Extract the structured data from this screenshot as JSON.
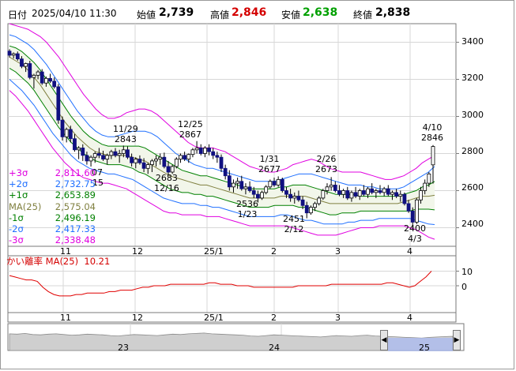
{
  "header": {
    "date_label": "日付",
    "datetime": "2025/04/10 11:30",
    "open_label": "始値",
    "open_value": "2,739",
    "high_label": "高値",
    "high_value": "2,846",
    "low_label": "安値",
    "low_value": "2,638",
    "close_label": "終値",
    "close_value": "2,838",
    "colors": {
      "high": "#d40000",
      "low": "#00a000"
    }
  },
  "legend": [
    {
      "label": "+3σ",
      "value": "2,811.60",
      "color": "#e000e0"
    },
    {
      "label": "+2σ",
      "value": "2,732.75",
      "color": "#2070ff"
    },
    {
      "label": "+1σ",
      "value": "2,653.89",
      "color": "#008000"
    },
    {
      "label": "MA(25)",
      "value": "2,575.04",
      "color": "#808040"
    },
    {
      "label": "-1σ",
      "value": "2,496.19",
      "color": "#008000"
    },
    {
      "label": "-2σ",
      "value": "2,417.33",
      "color": "#2070ff"
    },
    {
      "label": "-3σ",
      "value": "2,338.48",
      "color": "#e000e0"
    }
  ],
  "annotations": {
    "a_1129_date": "11/29",
    "a_1129_val": "2843",
    "a_1225_date": "12/25",
    "a_1225_val": "2867",
    "a_131_date": "1/31",
    "a_131_val": "2677",
    "a_226_date": "2/26",
    "a_226_val": "2673",
    "a_410_date": "4/10",
    "a_410_val": "2846",
    "a_1216_val": "2683",
    "a_1216_date": "12/16",
    "a_123_val": "2536",
    "a_123_date": "1/23",
    "a_212_val": "2451",
    "a_212_date": "2/12",
    "a_43_val": "2400",
    "a_43_date": "4/3",
    "partial_low_1": "07",
    "partial_low_2": "15"
  },
  "y_axis_labels": [
    "3400",
    "3200",
    "3000",
    "2800",
    "2600",
    "2400"
  ],
  "x_axis_labels": [
    "11",
    "12",
    "25/1",
    "2",
    "3",
    "4"
  ],
  "sub_indicator": {
    "label": "かい離率 MA(25)",
    "value": "10.21",
    "y_labels": [
      "10",
      "0"
    ]
  },
  "navigator": {
    "labels": [
      "23",
      "24",
      "25"
    ],
    "left_button": "◀",
    "right_button": "▶"
  },
  "chart_data": {
    "type": "candlestick",
    "y_range": [
      2300,
      3500
    ],
    "candles": [
      [
        3352,
        3362,
        3318,
        3330
      ],
      [
        3330,
        3345,
        3312,
        3338
      ],
      [
        3338,
        3350,
        3300,
        3310
      ],
      [
        3310,
        3325,
        3260,
        3270
      ],
      [
        3270,
        3290,
        3240,
        3285
      ],
      [
        3285,
        3300,
        3200,
        3210
      ],
      [
        3210,
        3230,
        3150,
        3222
      ],
      [
        3222,
        3250,
        3200,
        3240
      ],
      [
        3240,
        3255,
        3170,
        3180
      ],
      [
        3180,
        3215,
        3160,
        3205
      ],
      [
        3205,
        3230,
        3180,
        3190
      ],
      [
        3190,
        3210,
        3150,
        3160
      ],
      [
        3160,
        3175,
        2960,
        2980
      ],
      [
        2980,
        3000,
        2870,
        2890
      ],
      [
        2890,
        2940,
        2860,
        2930
      ],
      [
        2930,
        2950,
        2860,
        2880
      ],
      [
        2880,
        2905,
        2810,
        2820
      ],
      [
        2820,
        2840,
        2770,
        2830
      ],
      [
        2830,
        2850,
        2760,
        2790
      ],
      [
        2790,
        2810,
        2740,
        2760
      ],
      [
        2760,
        2790,
        2730,
        2780
      ],
      [
        2780,
        2810,
        2750,
        2800
      ],
      [
        2800,
        2830,
        2775,
        2790
      ],
      [
        2790,
        2815,
        2760,
        2770
      ],
      [
        2770,
        2800,
        2740,
        2790
      ],
      [
        2790,
        2820,
        2770,
        2810
      ],
      [
        2810,
        2830,
        2780,
        2790
      ],
      [
        2790,
        2820,
        2750,
        2800
      ],
      [
        2800,
        2843,
        2780,
        2820
      ],
      [
        2820,
        2838,
        2770,
        2780
      ],
      [
        2780,
        2800,
        2730,
        2750
      ],
      [
        2750,
        2780,
        2720,
        2770
      ],
      [
        2770,
        2790,
        2740,
        2750
      ],
      [
        2750,
        2775,
        2700,
        2720
      ],
      [
        2720,
        2750,
        2690,
        2740
      ],
      [
        2740,
        2770,
        2700,
        2760
      ],
      [
        2760,
        2790,
        2730,
        2770
      ],
      [
        2770,
        2800,
        2740,
        2780
      ],
      [
        2780,
        2805,
        2720,
        2730
      ],
      [
        2730,
        2760,
        2683,
        2700
      ],
      [
        2700,
        2740,
        2690,
        2730
      ],
      [
        2730,
        2780,
        2720,
        2770
      ],
      [
        2770,
        2800,
        2750,
        2790
      ],
      [
        2790,
        2810,
        2760,
        2770
      ],
      [
        2770,
        2800,
        2750,
        2795
      ],
      [
        2795,
        2830,
        2780,
        2820
      ],
      [
        2820,
        2867,
        2800,
        2830
      ],
      [
        2830,
        2850,
        2790,
        2800
      ],
      [
        2800,
        2840,
        2780,
        2830
      ],
      [
        2830,
        2850,
        2790,
        2810
      ],
      [
        2810,
        2830,
        2770,
        2790
      ],
      [
        2790,
        2810,
        2750,
        2780
      ],
      [
        2780,
        2795,
        2700,
        2720
      ],
      [
        2720,
        2740,
        2660,
        2680
      ],
      [
        2680,
        2710,
        2600,
        2620
      ],
      [
        2620,
        2660,
        2590,
        2640
      ],
      [
        2640,
        2670,
        2610,
        2650
      ],
      [
        2650,
        2680,
        2600,
        2610
      ],
      [
        2610,
        2640,
        2580,
        2620
      ],
      [
        2620,
        2650,
        2590,
        2600
      ],
      [
        2600,
        2620,
        2560,
        2580
      ],
      [
        2580,
        2600,
        2536,
        2560
      ],
      [
        2560,
        2600,
        2550,
        2590
      ],
      [
        2590,
        2630,
        2580,
        2620
      ],
      [
        2620,
        2660,
        2610,
        2650
      ],
      [
        2650,
        2670,
        2620,
        2630
      ],
      [
        2630,
        2677,
        2620,
        2660
      ],
      [
        2660,
        2670,
        2590,
        2600
      ],
      [
        2600,
        2620,
        2560,
        2580
      ],
      [
        2580,
        2610,
        2540,
        2560
      ],
      [
        2560,
        2590,
        2530,
        2570
      ],
      [
        2570,
        2600,
        2540,
        2550
      ],
      [
        2550,
        2570,
        2500,
        2520
      ],
      [
        2520,
        2540,
        2451,
        2480
      ],
      [
        2480,
        2520,
        2470,
        2510
      ],
      [
        2510,
        2540,
        2490,
        2530
      ],
      [
        2530,
        2570,
        2520,
        2560
      ],
      [
        2560,
        2610,
        2550,
        2600
      ],
      [
        2600,
        2640,
        2580,
        2620
      ],
      [
        2620,
        2673,
        2600,
        2630
      ],
      [
        2630,
        2650,
        2590,
        2600
      ],
      [
        2600,
        2630,
        2570,
        2580
      ],
      [
        2580,
        2610,
        2560,
        2600
      ],
      [
        2600,
        2620,
        2550,
        2560
      ],
      [
        2560,
        2600,
        2540,
        2590
      ],
      [
        2590,
        2620,
        2560,
        2570
      ],
      [
        2570,
        2610,
        2550,
        2600
      ],
      [
        2600,
        2630,
        2570,
        2580
      ],
      [
        2580,
        2620,
        2560,
        2610
      ],
      [
        2610,
        2640,
        2580,
        2590
      ],
      [
        2590,
        2610,
        2560,
        2600
      ],
      [
        2600,
        2630,
        2580,
        2590
      ],
      [
        2590,
        2620,
        2570,
        2610
      ],
      [
        2610,
        2630,
        2570,
        2580
      ],
      [
        2580,
        2600,
        2550,
        2590
      ],
      [
        2590,
        2610,
        2560,
        2570
      ],
      [
        2570,
        2600,
        2540,
        2580
      ],
      [
        2580,
        2590,
        2520,
        2530
      ],
      [
        2530,
        2550,
        2480,
        2490
      ],
      [
        2490,
        2510,
        2400,
        2430
      ],
      [
        2430,
        2560,
        2420,
        2550
      ],
      [
        2550,
        2620,
        2530,
        2600
      ],
      [
        2600,
        2660,
        2580,
        2640
      ],
      [
        2640,
        2700,
        2620,
        2690
      ],
      [
        2739,
        2846,
        2638,
        2838
      ]
    ],
    "sigma_series": {
      "p3": [
        3500,
        3490,
        3480,
        3470,
        3450,
        3430,
        3400,
        3360,
        3320,
        3270,
        3220,
        3170,
        3120,
        3080,
        3040,
        3010,
        2990,
        2990,
        3000,
        3020,
        3030,
        3040,
        3040,
        3030,
        3010,
        2980,
        2950,
        2920,
        2890,
        2860,
        2840,
        2830,
        2830,
        2830,
        2820,
        2810,
        2790,
        2770,
        2750,
        2730,
        2720,
        2710,
        2700,
        2700,
        2710,
        2720,
        2740,
        2750,
        2760,
        2770,
        2760,
        2740,
        2720,
        2710,
        2700,
        2700,
        2700,
        2700,
        2690,
        2680,
        2670,
        2660,
        2660,
        2670,
        2680,
        2700,
        2720,
        2750,
        2770,
        2790
      ],
      "p2": [
        3440,
        3430,
        3410,
        3390,
        3360,
        3320,
        3280,
        3230,
        3180,
        3130,
        3080,
        3030,
        2990,
        2950,
        2920,
        2900,
        2890,
        2890,
        2900,
        2910,
        2920,
        2920,
        2920,
        2910,
        2890,
        2860,
        2830,
        2800,
        2780,
        2760,
        2740,
        2730,
        2720,
        2720,
        2710,
        2700,
        2690,
        2680,
        2670,
        2660,
        2650,
        2650,
        2650,
        2650,
        2660,
        2670,
        2680,
        2690,
        2690,
        2690,
        2680,
        2670,
        2660,
        2650,
        2640,
        2630,
        2630,
        2630,
        2620,
        2620,
        2610,
        2610,
        2610,
        2610,
        2620,
        2640,
        2660,
        2680,
        2700,
        2730
      ],
      "p1": [
        3380,
        3370,
        3350,
        3320,
        3290,
        3250,
        3200,
        3150,
        3100,
        3050,
        3000,
        2960,
        2920,
        2890,
        2870,
        2850,
        2840,
        2840,
        2840,
        2840,
        2840,
        2840,
        2830,
        2810,
        2790,
        2770,
        2750,
        2730,
        2710,
        2700,
        2690,
        2680,
        2680,
        2670,
        2660,
        2650,
        2640,
        2630,
        2620,
        2610,
        2610,
        2610,
        2610,
        2610,
        2620,
        2620,
        2630,
        2630,
        2630,
        2620,
        2610,
        2600,
        2590,
        2580,
        2580,
        2580,
        2580,
        2570,
        2570,
        2570,
        2570,
        2570,
        2570,
        2570,
        2580,
        2590,
        2600,
        2620,
        2630,
        2650
      ],
      "ma": [
        3320,
        3300,
        3280,
        3250,
        3210,
        3170,
        3120,
        3070,
        3020,
        2970,
        2930,
        2890,
        2860,
        2830,
        2810,
        2800,
        2790,
        2790,
        2790,
        2790,
        2780,
        2770,
        2760,
        2740,
        2720,
        2700,
        2680,
        2670,
        2660,
        2650,
        2640,
        2630,
        2630,
        2620,
        2610,
        2600,
        2590,
        2580,
        2570,
        2560,
        2560,
        2560,
        2560,
        2560,
        2570,
        2570,
        2570,
        2570,
        2570,
        2560,
        2550,
        2540,
        2530,
        2530,
        2530,
        2530,
        2530,
        2530,
        2530,
        2530,
        2530,
        2530,
        2530,
        2530,
        2540,
        2550,
        2560,
        2570,
        2570,
        2575
      ],
      "m1": [
        3260,
        3240,
        3210,
        3180,
        3140,
        3090,
        3040,
        2990,
        2940,
        2900,
        2860,
        2830,
        2800,
        2780,
        2760,
        2750,
        2740,
        2740,
        2740,
        2730,
        2720,
        2700,
        2690,
        2670,
        2650,
        2630,
        2610,
        2600,
        2590,
        2590,
        2580,
        2580,
        2570,
        2570,
        2560,
        2550,
        2540,
        2530,
        2520,
        2510,
        2510,
        2510,
        2510,
        2520,
        2520,
        2520,
        2520,
        2510,
        2510,
        2500,
        2490,
        2480,
        2470,
        2470,
        2480,
        2480,
        2480,
        2490,
        2490,
        2490,
        2490,
        2490,
        2490,
        2490,
        2490,
        2490,
        2500,
        2500,
        2500,
        2496
      ],
      "m2": [
        3200,
        3170,
        3140,
        3100,
        3060,
        3010,
        2960,
        2910,
        2870,
        2830,
        2790,
        2760,
        2740,
        2720,
        2710,
        2700,
        2690,
        2690,
        2680,
        2670,
        2660,
        2640,
        2620,
        2600,
        2580,
        2560,
        2550,
        2540,
        2530,
        2530,
        2530,
        2520,
        2520,
        2510,
        2510,
        2500,
        2490,
        2480,
        2470,
        2460,
        2460,
        2460,
        2460,
        2460,
        2470,
        2470,
        2460,
        2450,
        2440,
        2440,
        2430,
        2420,
        2420,
        2420,
        2420,
        2430,
        2430,
        2440,
        2440,
        2440,
        2450,
        2450,
        2450,
        2450,
        2450,
        2450,
        2440,
        2430,
        2420,
        2417
      ],
      "m3": [
        3140,
        3110,
        3070,
        3030,
        2980,
        2930,
        2880,
        2830,
        2790,
        2750,
        2720,
        2690,
        2670,
        2660,
        2650,
        2640,
        2640,
        2630,
        2620,
        2610,
        2590,
        2570,
        2550,
        2530,
        2510,
        2490,
        2480,
        2480,
        2470,
        2470,
        2470,
        2470,
        2460,
        2460,
        2460,
        2450,
        2440,
        2430,
        2420,
        2410,
        2410,
        2410,
        2410,
        2410,
        2410,
        2410,
        2400,
        2390,
        2380,
        2370,
        2360,
        2360,
        2360,
        2360,
        2370,
        2380,
        2390,
        2400,
        2400,
        2400,
        2410,
        2410,
        2410,
        2410,
        2410,
        2400,
        2390,
        2370,
        2350,
        2338
      ]
    },
    "deviation_rate": [
      7,
      6,
      5,
      4,
      4,
      3,
      -1,
      -4,
      -6,
      -7,
      -7,
      -7,
      -6,
      -6,
      -5,
      -5,
      -5,
      -5,
      -4,
      -4,
      -3,
      -3,
      -3,
      -2,
      -1,
      -1,
      0,
      0,
      0,
      1,
      1,
      1,
      1,
      1,
      1,
      1,
      2,
      2,
      1,
      1,
      1,
      0,
      0,
      0,
      -1,
      -1,
      -1,
      -1,
      -1,
      -1,
      -1,
      -1,
      0,
      0,
      0,
      0,
      0,
      0,
      1,
      1,
      1,
      1,
      1,
      1,
      1,
      1,
      1,
      1,
      2,
      2,
      1,
      0,
      -1,
      0,
      3,
      6,
      10
    ],
    "navigator_series": [
      47,
      46,
      48,
      45,
      44,
      46,
      47,
      45,
      43,
      44,
      46,
      45,
      44,
      42,
      41,
      43,
      45,
      44,
      43,
      42,
      44,
      46,
      45,
      47,
      48,
      49,
      47,
      46,
      45,
      44,
      43,
      41,
      40,
      42,
      44,
      43,
      42,
      41,
      40,
      39,
      38,
      40,
      42,
      41,
      40,
      42,
      43,
      41,
      40,
      39,
      38,
      37,
      36,
      35,
      37,
      38,
      39,
      40
    ]
  }
}
